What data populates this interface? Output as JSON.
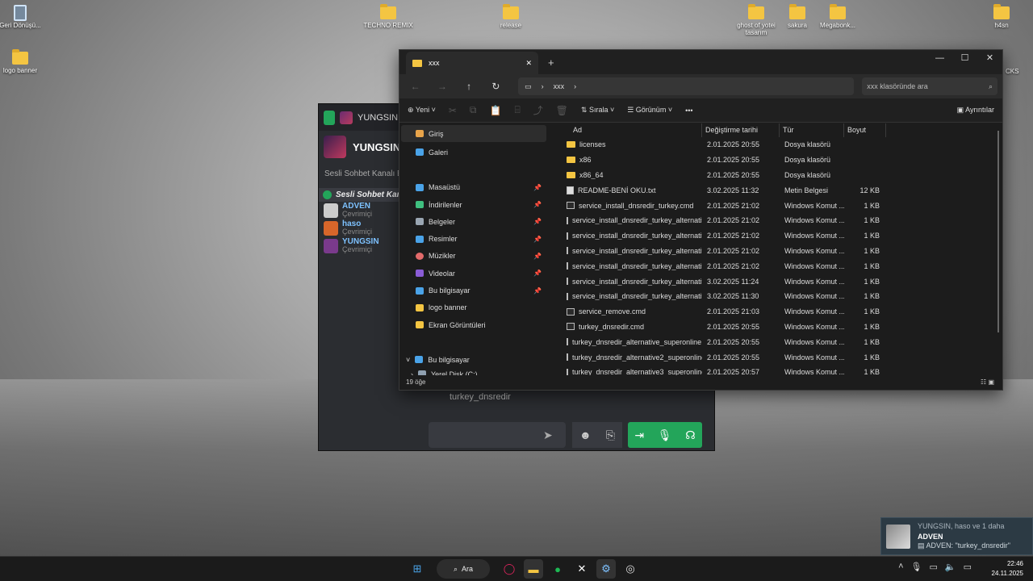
{
  "desktop": {
    "icons": [
      {
        "label": "Geri Dönüşü..."
      },
      {
        "label": "logo banner"
      },
      {
        "label": "TECHNO REMIX"
      },
      {
        "label": "release"
      },
      {
        "label": "ghost of yotei tasarım"
      },
      {
        "label": "sakura"
      },
      {
        "label": "Megabonk..."
      },
      {
        "label": "h4sn"
      }
    ],
    "partial_label": "CKS"
  },
  "chat": {
    "top_user": "YUNGSIN, ha",
    "header_user": "YUNGSIN,",
    "subtitle": "Sesli Sohbet Kanalı E",
    "voice_channel": "Sesli Sohbet Kana",
    "members": [
      {
        "name": "ADVEN",
        "status": "Çevrimiçi"
      },
      {
        "name": "haso",
        "status": "Çevrimiçi"
      },
      {
        "name": "YUNGSIN",
        "status": "Çevrimiçi"
      }
    ],
    "last_message": "turkey_dnsredir"
  },
  "explorer": {
    "tab_title": "xxx",
    "breadcrumb": "xxx",
    "search_placeholder": "xxx klasöründe ara",
    "toolbar": {
      "new": "Yeni",
      "sort": "Sırala",
      "view": "Görünüm",
      "details": "Ayrıntılar"
    },
    "sidebar": {
      "home": "Giriş",
      "gallery": "Galeri",
      "pinned": [
        "Masaüstü",
        "İndirilenler",
        "Belgeler",
        "Resimler",
        "Müzikler",
        "Videolar",
        "Bu bilgisayar"
      ],
      "others": [
        "logo banner",
        "Ekran Görüntüleri"
      ],
      "this_pc": "Bu bilgisayar",
      "disk": "Yerel Disk (C:)"
    },
    "columns": [
      "Ad",
      "Değiştirme tarihi",
      "Tür",
      "Boyut"
    ],
    "files": [
      {
        "name": "licenses",
        "date": "2.01.2025 20:55",
        "type": "Dosya klasörü",
        "size": "",
        "kind": "folder"
      },
      {
        "name": "x86",
        "date": "2.01.2025 20:55",
        "type": "Dosya klasörü",
        "size": "",
        "kind": "folder"
      },
      {
        "name": "x86_64",
        "date": "2.01.2025 20:55",
        "type": "Dosya klasörü",
        "size": "",
        "kind": "folder"
      },
      {
        "name": "README-BENİ OKU.txt",
        "date": "3.02.2025 11:32",
        "type": "Metin Belgesi",
        "size": "12 KB",
        "kind": "txt"
      },
      {
        "name": "service_install_dnsredir_turkey.cmd",
        "date": "2.01.2025 21:02",
        "type": "Windows Komut ...",
        "size": "1 KB",
        "kind": "cmd"
      },
      {
        "name": "service_install_dnsredir_turkey_alternativ...",
        "date": "2.01.2025 21:02",
        "type": "Windows Komut ...",
        "size": "1 KB",
        "kind": "cmd"
      },
      {
        "name": "service_install_dnsredir_turkey_alternativ...",
        "date": "2.01.2025 21:02",
        "type": "Windows Komut ...",
        "size": "1 KB",
        "kind": "cmd"
      },
      {
        "name": "service_install_dnsredir_turkey_alternativ...",
        "date": "2.01.2025 21:02",
        "type": "Windows Komut ...",
        "size": "1 KB",
        "kind": "cmd"
      },
      {
        "name": "service_install_dnsredir_turkey_alternativ...",
        "date": "2.01.2025 21:02",
        "type": "Windows Komut ...",
        "size": "1 KB",
        "kind": "cmd"
      },
      {
        "name": "service_install_dnsredir_turkey_alternativ...",
        "date": "3.02.2025 11:24",
        "type": "Windows Komut ...",
        "size": "1 KB",
        "kind": "cmd"
      },
      {
        "name": "service_install_dnsredir_turkey_alternativ...",
        "date": "3.02.2025 11:30",
        "type": "Windows Komut ...",
        "size": "1 KB",
        "kind": "cmd"
      },
      {
        "name": "service_remove.cmd",
        "date": "2.01.2025 21:03",
        "type": "Windows Komut ...",
        "size": "1 KB",
        "kind": "cmd"
      },
      {
        "name": "turkey_dnsredir.cmd",
        "date": "2.01.2025 20:55",
        "type": "Windows Komut ...",
        "size": "1 KB",
        "kind": "cmd"
      },
      {
        "name": "turkey_dnsredir_alternative_superonline.c...",
        "date": "2.01.2025 20:55",
        "type": "Windows Komut ...",
        "size": "1 KB",
        "kind": "cmd"
      },
      {
        "name": "turkey_dnsredir_alternative2_superonline....",
        "date": "2.01.2025 20:55",
        "type": "Windows Komut ...",
        "size": "1 KB",
        "kind": "cmd"
      },
      {
        "name": "turkey_dnsredir_alternative3_superonline....",
        "date": "2.01.2025 20:57",
        "type": "Windows Komut ...",
        "size": "1 KB",
        "kind": "cmd"
      }
    ],
    "status": "19 öğe"
  },
  "notification": {
    "line1": "YUNGSIN, haso ve 1 daha",
    "line2": "ADVEN",
    "line3": "ADVEN: \"turkey_dnsredir\""
  },
  "taskbar": {
    "search": "Ara",
    "time": "22:46",
    "date": "24.11.2025"
  },
  "colors": {
    "accent_green": "#23a55a",
    "folder_yellow": "#f4c542",
    "explorer_bg": "#1c1c1c"
  }
}
